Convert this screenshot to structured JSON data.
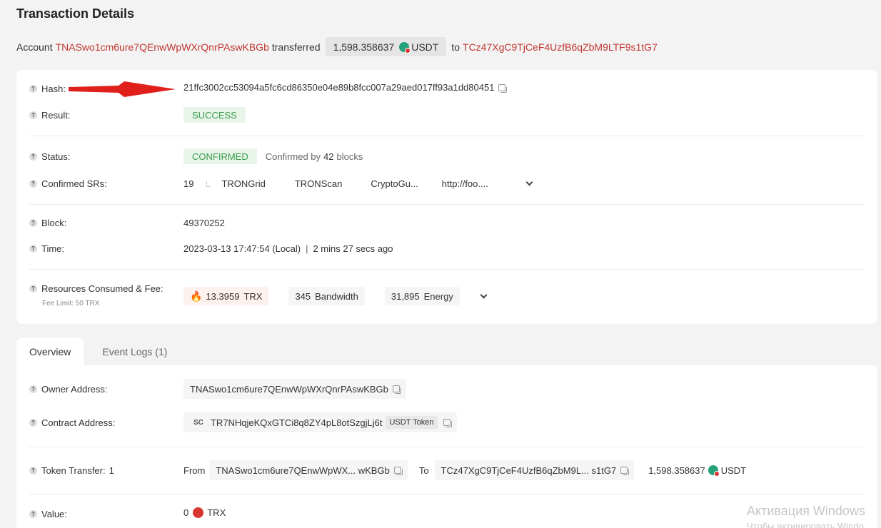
{
  "page_title": "Transaction Details",
  "summary": {
    "account_prefix": "Account",
    "from_address": "TNASwo1cm6ure7QEnwWpWXrQnrPAswKBGb",
    "transferred": "transferred",
    "amount": "1,598.358637",
    "token": "USDT",
    "to_word": "to",
    "to_address": "TCz47XgC9TjCeF4UzfB6qZbM9LTF9s1tG7"
  },
  "details": {
    "hash_label": "Hash:",
    "hash_value": "21ffc3002cc53094a5fc6cd86350e04e89b8fcc007a29aed017ff93a1dd80451",
    "result_label": "Result:",
    "result_value": "SUCCESS",
    "status_label": "Status:",
    "status_value": "CONFIRMED",
    "confirmed_by_prefix": "Confirmed by",
    "confirmed_blocks": "42",
    "confirmed_by_suffix": "blocks",
    "confirmed_srs_label": "Confirmed SRs:",
    "confirmed_srs_count": "19",
    "srs": [
      "TRONGrid",
      "TRONScan",
      "CryptoGu...",
      "http://foo...."
    ],
    "block_label": "Block:",
    "block_value": "49370252",
    "time_label": "Time:",
    "time_value": "2023-03-13 17:47:54 (Local)",
    "time_separator": "|",
    "time_ago": "2 mins 27 secs ago",
    "resources_label": "Resources Consumed & Fee:",
    "fee_limit": "Fee Limit: 50 TRX",
    "trx_fee": "13.3959",
    "trx_unit": "TRX",
    "bandwidth_value": "345",
    "bandwidth_unit": "Bandwidth",
    "energy_value": "31,895",
    "energy_unit": "Energy"
  },
  "tabs": {
    "overview": "Overview",
    "event_logs": "Event Logs (1)"
  },
  "overview": {
    "owner_label": "Owner Address:",
    "owner_value": "TNASwo1cm6ure7QEnwWpWXrQnrPAswKBGb",
    "contract_label": "Contract Address:",
    "contract_sc": "SC",
    "contract_value": "TR7NHqjeKQxGTCi8q8ZY4pL8otSzgjLj6t",
    "contract_token_tag": "USDT Token",
    "token_transfer_label": "Token Transfer:",
    "token_transfer_count": "1",
    "from_word": "From",
    "from_short": "TNASwo1cm6ure7QEnwWpWX... wKBGb",
    "to_word": "To",
    "to_short": "TCz47XgC9TjCeF4UzfB6qZbM9L... s1tG7",
    "transfer_amount": "1,598.358637",
    "transfer_token": "USDT",
    "value_label": "Value:",
    "value_amount": "0",
    "value_unit": "TRX"
  },
  "watermark": {
    "line1": "Активация Windows",
    "line2": "Чтобы активировать Windo"
  },
  "colors": {
    "link": "#c23631",
    "success_bg": "#e8f5e9",
    "success_text": "#3a9b4b",
    "annotation_arrow": "#e0201b"
  }
}
